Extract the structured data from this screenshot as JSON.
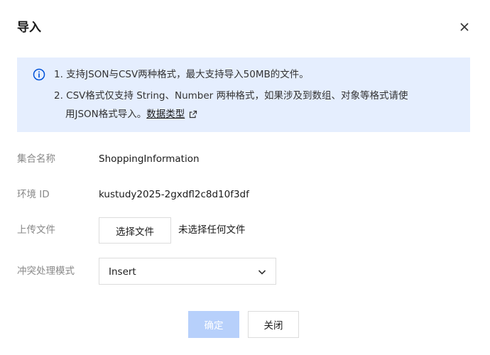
{
  "dialog": {
    "title": "导入",
    "close_icon": "close-icon"
  },
  "notice": {
    "icon": "info-icon",
    "line1": "1. 支持JSON与CSV两种格式，最大支持导入50MB的文件。",
    "line2": "2. CSV格式仅支持 String、Number 两种格式，如果涉及到数组、对象等格式请使",
    "line3_prefix": "用JSON格式导入。",
    "line3_link": "数据类型",
    "link_icon": "external-link-icon"
  },
  "form": {
    "collection_label": "集合名称",
    "collection_value": "ShoppingInformation",
    "env_label": "环境 ID",
    "env_value": "kustudy2025-2gxdfl2c8d10f3df",
    "upload_label": "上传文件",
    "upload_button": "选择文件",
    "upload_status": "未选择任何文件",
    "conflict_label": "冲突处理模式",
    "conflict_value": "Insert",
    "conflict_icon": "chevron-down-icon"
  },
  "footer": {
    "confirm_label": "确定",
    "close_label": "关闭"
  },
  "colors": {
    "notice_bg": "#e5eefe",
    "accent": "#0052d9",
    "confirm_disabled": "#b7d0fb"
  }
}
